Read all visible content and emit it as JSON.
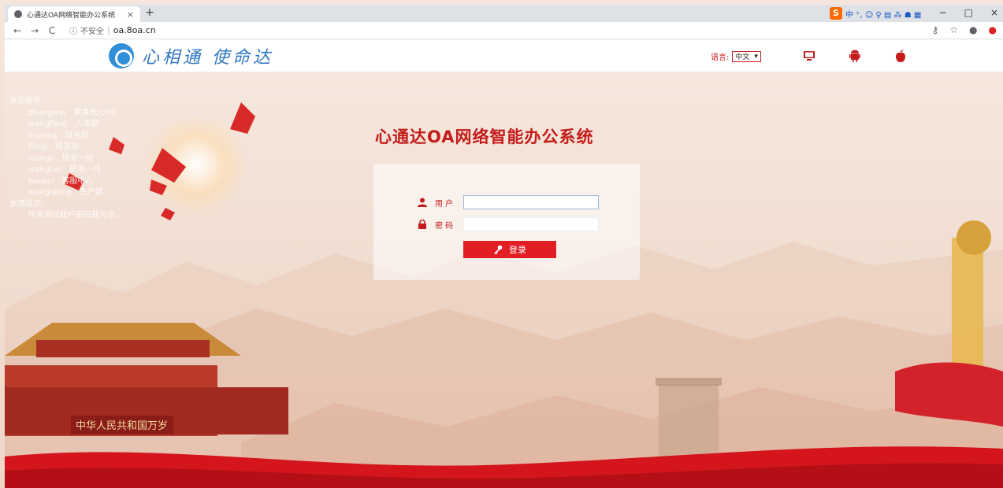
{
  "browser": {
    "tab_title": "心通达OA网络智能办公系统",
    "tab_close": "×",
    "new_tab": "+",
    "insecure_label": "不安全",
    "url": "oa.8oa.cn",
    "tray_text": "中 ⁺, ☺ ♀ ▤ ⁂ ☗ ▦",
    "controls": [
      "−",
      "□",
      "×"
    ]
  },
  "header": {
    "logo_text": "心相通 使命达",
    "lang_label": "语言:",
    "lang_value": "中文",
    "platforms": [
      "desktop-icon",
      "android-icon",
      "apple-icon"
    ]
  },
  "accounts": {
    "heading": "体验帐号:",
    "list": [
      {
        "user": "zhangwei",
        "role": "董事长/CFO"
      },
      {
        "user": "wangfang",
        "role": "人事部"
      },
      {
        "user": "liuyang",
        "role": "财务部"
      },
      {
        "user": "lihua",
        "role": "研发部"
      },
      {
        "user": "wangli",
        "role": "研发一组"
      },
      {
        "user": "wanghai",
        "role": "研发一组"
      },
      {
        "user": "baiwei",
        "role": "客服中心"
      },
      {
        "user": "wangqiang",
        "role": "生产部"
      }
    ],
    "hint_heading": "友情提示:",
    "hint_text": "所有测试帐户密码都为空。"
  },
  "login": {
    "title": "心通达OA网络智能办公系统",
    "user_label": "用户",
    "user_value": "",
    "pass_label": "密码",
    "pass_value": "",
    "button_label": "登录"
  },
  "colors": {
    "brand_red": "#c41b1b",
    "button_red": "#e11e24",
    "logo_blue": "#2f8fd8"
  }
}
